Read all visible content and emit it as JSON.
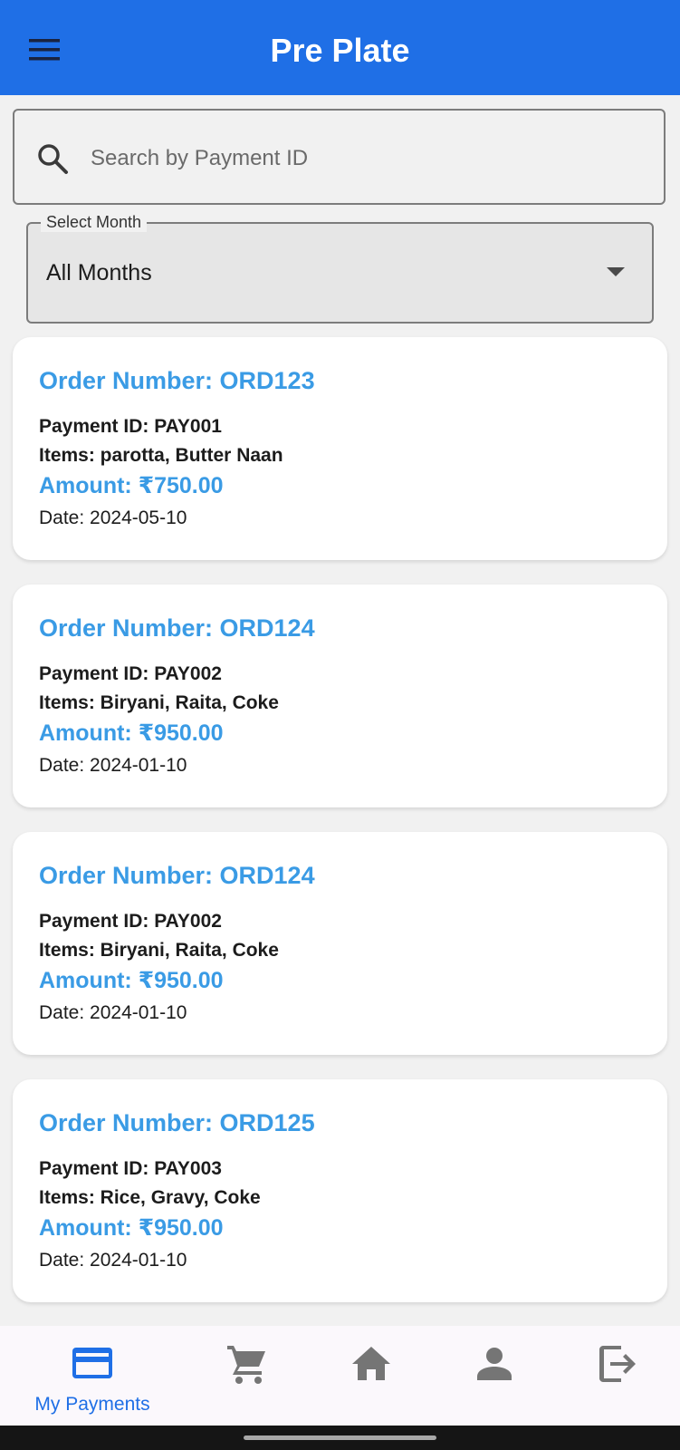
{
  "appbar": {
    "title": "Pre Plate",
    "menu_icon": "menu-icon"
  },
  "search": {
    "placeholder": "Search by Payment ID",
    "value": "",
    "icon": "search-icon"
  },
  "month_filter": {
    "label": "Select Month",
    "selected": "All Months",
    "icon": "dropdown-arrow-icon"
  },
  "orders": [
    {
      "order": "Order Number: ORD123",
      "payment_id": "Payment ID: PAY001",
      "items": "Items: parotta, Butter Naan",
      "amount": "Amount: ₹750.00",
      "date": "Date: 2024-05-10"
    },
    {
      "order": "Order Number: ORD124",
      "payment_id": "Payment ID: PAY002",
      "items": "Items: Biryani, Raita, Coke",
      "amount": "Amount: ₹950.00",
      "date": "Date: 2024-01-10"
    },
    {
      "order": "Order Number: ORD124",
      "payment_id": "Payment ID: PAY002",
      "items": "Items: Biryani, Raita, Coke",
      "amount": "Amount: ₹950.00",
      "date": "Date: 2024-01-10"
    },
    {
      "order": "Order Number: ORD125",
      "payment_id": "Payment ID: PAY003",
      "items": "Items: Rice, Gravy, Coke",
      "amount": "Amount: ₹950.00",
      "date": "Date: 2024-01-10"
    }
  ],
  "bottom_nav": {
    "items": [
      {
        "label": "My Payments",
        "icon": "credit-card-icon",
        "active": true
      },
      {
        "label": "",
        "icon": "cart-icon",
        "active": false
      },
      {
        "label": "",
        "icon": "home-icon",
        "active": false
      },
      {
        "label": "",
        "icon": "person-icon",
        "active": false
      },
      {
        "label": "",
        "icon": "logout-icon",
        "active": false
      }
    ]
  },
  "colors": {
    "primary": "#1f6fe6",
    "accent_text": "#3a9be5",
    "inactive_icon": "#757575",
    "background": "#f1f1f1"
  }
}
